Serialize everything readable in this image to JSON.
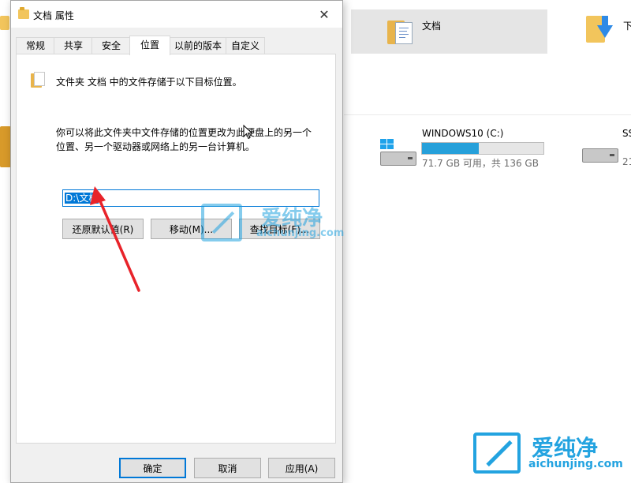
{
  "explorer": {
    "selected_folder_label": "文档",
    "next_folder_label_partial": "下",
    "drives": [
      {
        "name": "WINDOWS10 (C:)",
        "info": "71.7 GB 可用，共 136 GB",
        "used_fraction": 0.47
      },
      {
        "name": "SS",
        "info": "21"
      }
    ]
  },
  "dialog": {
    "title": "文档 属性",
    "close_glyph": "✕",
    "tabs": [
      "常规",
      "共享",
      "安全",
      "位置",
      "以前的版本",
      "自定义"
    ],
    "active_tab": "位置",
    "heading": "文件夹 文档 中的文件存储于以下目标位置。",
    "description": "你可以将此文件夹中文件存储的位置更改为此硬盘上的另一个位置、另一个驱动器或网络上的另一台计算机。",
    "path_value": "D:\\文档",
    "buttons": {
      "restore_default": "还原默认值(R)",
      "move": "移动(M)...",
      "find_target": "查找目标(F)..."
    },
    "footer": {
      "ok": "确定",
      "cancel": "取消",
      "apply": "应用(A)"
    }
  },
  "watermark": {
    "title": "爱纯净",
    "subtitle": "aichunjing.com"
  },
  "colors": {
    "accent": "#0078d7",
    "watermark": "#23a3e0",
    "arrow": "#e8232a"
  }
}
